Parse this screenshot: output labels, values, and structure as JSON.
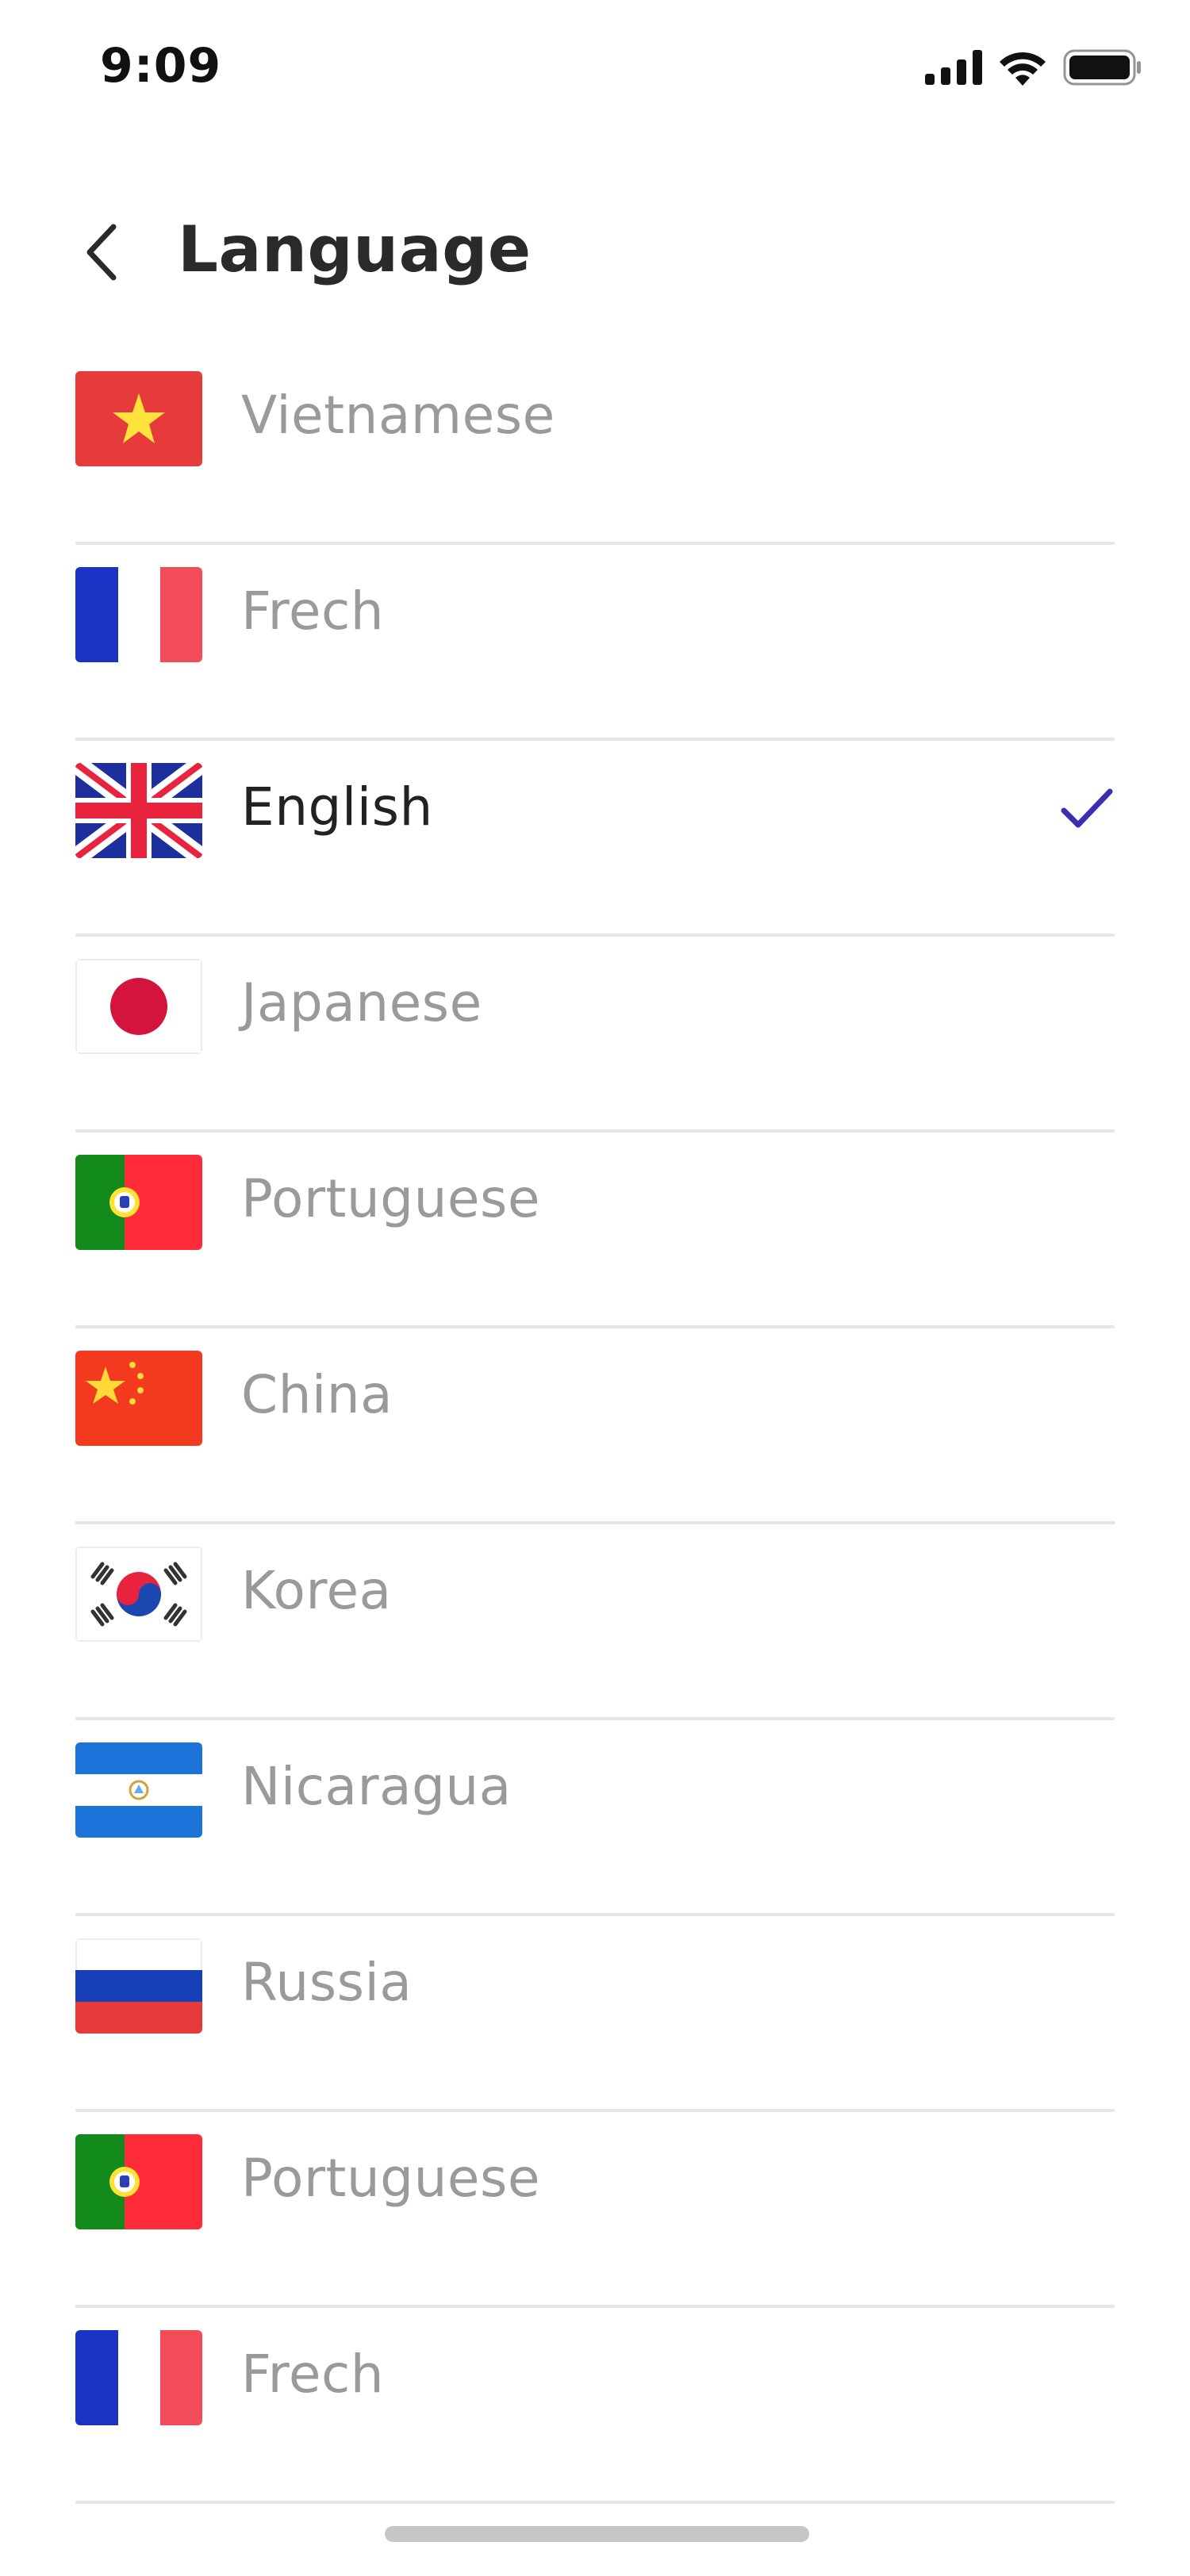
{
  "status_bar": {
    "time": "9:09"
  },
  "header": {
    "title": "Language"
  },
  "languages": [
    {
      "label": "Vietnamese",
      "flag": "vietnam-flag",
      "selected": false
    },
    {
      "label": "Frech",
      "flag": "france-flag",
      "selected": false
    },
    {
      "label": "English",
      "flag": "uk-flag",
      "selected": true
    },
    {
      "label": "Japanese",
      "flag": "japan-flag",
      "selected": false
    },
    {
      "label": "Portuguese",
      "flag": "portugal-flag",
      "selected": false
    },
    {
      "label": "China",
      "flag": "china-flag",
      "selected": false
    },
    {
      "label": "Korea",
      "flag": "korea-flag",
      "selected": false
    },
    {
      "label": "Nicaragua",
      "flag": "nicaragua-flag",
      "selected": false
    },
    {
      "label": "Russia",
      "flag": "russia-flag",
      "selected": false
    },
    {
      "label": "Portuguese",
      "flag": "portugal-flag",
      "selected": false
    },
    {
      "label": "Frech",
      "flag": "france-flag",
      "selected": false
    }
  ],
  "colors": {
    "accent": "#3a2fb0",
    "text_selected": "#222222",
    "text_muted": "#9a9a9a",
    "divider": "#e6e6e6"
  }
}
